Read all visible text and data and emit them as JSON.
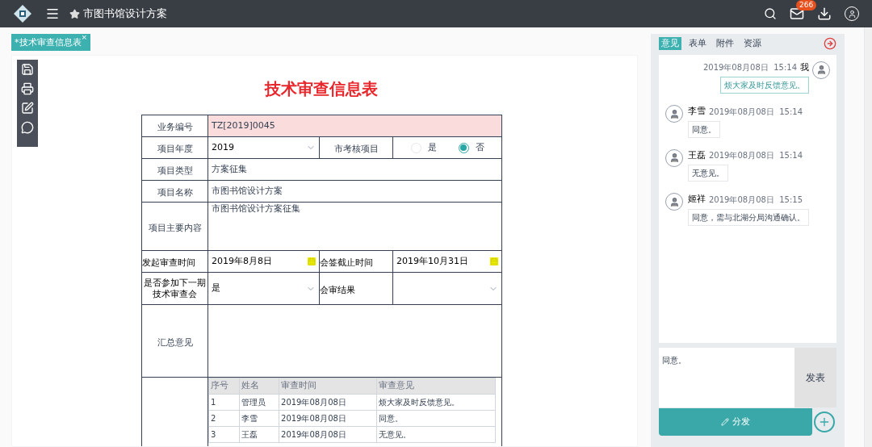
{
  "topbar": {
    "title": "市图书馆设计方案",
    "badge": "266"
  },
  "doc_tab": {
    "label": "*技术审查信息表",
    "close": "×",
    "selected": true
  },
  "form": {
    "title": "技术审查信息表",
    "rows": [
      {
        "kind": "text",
        "label": "业务编号",
        "value": "TZ[2019]0045",
        "highlighted": true
      },
      {
        "kind": "select_radio",
        "label": "项目年度",
        "value": "2019",
        "label2": "市考核项目",
        "options": [
          {
            "label": "是",
            "selected": false
          },
          {
            "label": "否",
            "selected": true
          }
        ]
      },
      {
        "kind": "text",
        "label": "项目类型",
        "value": "方案征集",
        "highlighted": false
      },
      {
        "kind": "text",
        "label": "项目名称",
        "value": "市图书馆设计方案",
        "highlighted": false
      },
      {
        "kind": "textarea",
        "label": "项目主要内容",
        "value": "市图书馆设计方案征集"
      },
      {
        "kind": "dates",
        "label": "发起审查时间",
        "value": "2019年8月8日",
        "label2": "会签截止时间",
        "value2": "2019年10月31日"
      },
      {
        "kind": "selects",
        "label": "是否参加下一期技术审查会",
        "value": "是",
        "label2": "会审结果"
      },
      {
        "kind": "blank",
        "label": "汇总意见"
      },
      {
        "kind": "records",
        "columns": [
          "序号",
          "姓名",
          "审查时间",
          "审查意见"
        ],
        "rows": [
          [
            "1",
            "管理员",
            "2019年08月08日",
            "烦大家及时反馈意见。"
          ],
          [
            "2",
            "李雪",
            "2019年08月08日",
            "同意。"
          ],
          [
            "3",
            "王磊",
            "2019年08月08日",
            "无意见。"
          ]
        ]
      }
    ]
  },
  "panel": {
    "tabs": [
      {
        "label": "意见",
        "selected": true
      },
      {
        "label": "表单",
        "selected": false
      },
      {
        "label": "附件",
        "selected": false
      },
      {
        "label": "资源",
        "selected": false
      }
    ],
    "messages": [
      {
        "author": "我",
        "time": "2019年08月08日  15:14",
        "text": "烦大家及时反馈意见。",
        "mine": true
      },
      {
        "author": "李雪",
        "time": "2019年08月08日  15:14",
        "text": "同意。",
        "mine": false
      },
      {
        "author": "王磊",
        "time": "2019年08月08日  15:14",
        "text": "无意见。",
        "mine": false
      },
      {
        "author": "姬祥",
        "time": "2019年08月08日  15:15",
        "text": "同意，需与北湖分局沟通确认。",
        "mine": false
      }
    ],
    "input": "同意。",
    "submit": "发表",
    "distribute": "分发"
  }
}
